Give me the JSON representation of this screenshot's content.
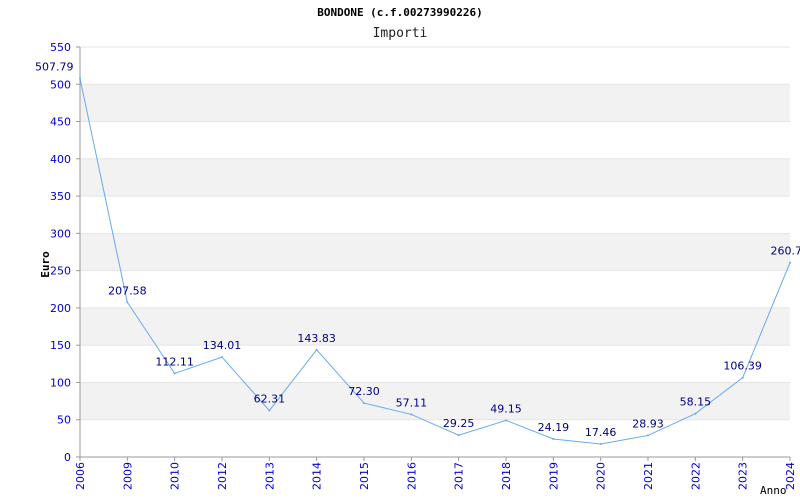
{
  "chart_data": {
    "type": "line",
    "title": "BONDONE (c.f.00273990226)",
    "subtitle": "Importi",
    "ylabel": "Euro",
    "xlabel": "Anno",
    "categories": [
      "2006",
      "2009",
      "2010",
      "2012",
      "2013",
      "2014",
      "2015",
      "2016",
      "2017",
      "2018",
      "2019",
      "2020",
      "2021",
      "2022",
      "2023",
      "2024"
    ],
    "series": [
      {
        "values": [
          507.79,
          207.58,
          112.11,
          134.01,
          62.31,
          143.83,
          72.3,
          57.11,
          29.25,
          49.15,
          24.19,
          17.46,
          28.93,
          58.15,
          106.39,
          260.7
        ]
      }
    ],
    "data_labels": [
      "507.79",
      "207.58",
      "112.11",
      "134.01",
      "62.31",
      "143.83",
      "72.30",
      "57.11",
      "29.25",
      "49.15",
      "24.19",
      "17.46",
      "28.93",
      "58.15",
      "106.39",
      "260.7"
    ],
    "ylim": [
      0,
      550
    ],
    "yticks": [
      "0",
      "50",
      "100",
      "150",
      "200",
      "250",
      "300",
      "350",
      "400",
      "450",
      "500",
      "550"
    ],
    "grid": true,
    "colors": {
      "line": "#66aaee",
      "band": "#f2f2f2",
      "tick_text": "#0000cc",
      "label_text": "#000080"
    }
  }
}
